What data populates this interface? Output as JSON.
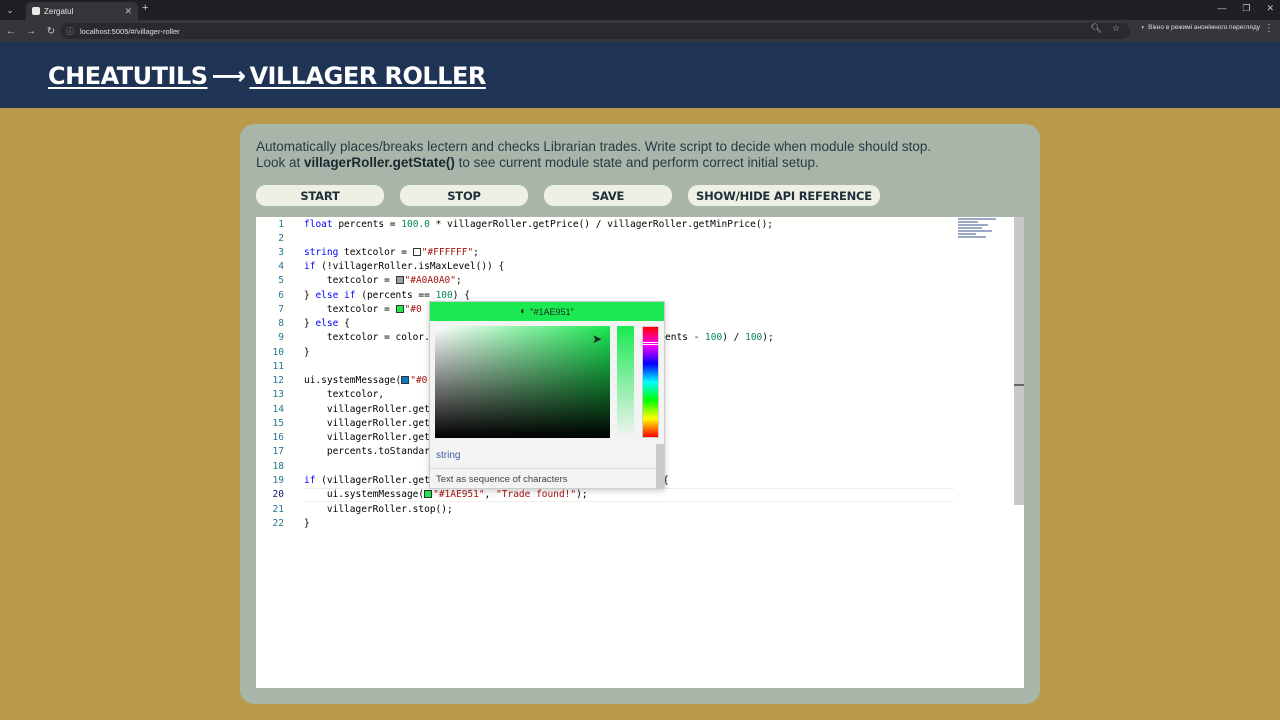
{
  "browser": {
    "tab_title": "Zergatul",
    "url": "localhost:5005/#/villager-roller",
    "incognito_label": "Вікно в режимі анонімного перегляду"
  },
  "header": {
    "crumb1": "CHEATUTILS",
    "arrow": "⟶",
    "crumb2": "VILLAGER ROLLER"
  },
  "description": {
    "line1": "Automatically places/breaks lectern and checks Librarian trades. Write script to decide when module should stop.",
    "line2_prefix": "Look at ",
    "line2_bold": "villagerRoller.getState()",
    "line2_suffix": " to see current module state and perform correct initial setup."
  },
  "buttons": {
    "start": "START",
    "stop": "STOP",
    "save": "SAVE",
    "api": "SHOW/HIDE API REFERENCE"
  },
  "editor": {
    "line_numbers": [
      "1",
      "2",
      "3",
      "4",
      "5",
      "6",
      "7",
      "8",
      "9",
      "10",
      "11",
      "12",
      "13",
      "14",
      "15",
      "16",
      "17",
      "18",
      "19",
      "20",
      "21",
      "22"
    ],
    "lines": {
      "l1a": "float",
      "l1b": " percents = ",
      "l1c": "100.0",
      "l1d": " * villagerRoller.getPrice() / villagerRoller.getMinPrice();",
      "l3a": "string",
      "l3b": " textcolor = ",
      "l3c": "\"#FFFFFF\"",
      "l3d": ";",
      "l4a": "if",
      "l4b": " (!villagerRoller.isMaxLevel()) {",
      "l5a": "    textcolor = ",
      "l5b": "\"#A0A0A0\"",
      "l5c": ";",
      "l6a": "} ",
      "l6b": "else if",
      "l6c": " (percents == ",
      "l6d": "100",
      "l6e": ") {",
      "l7a": "    textcolor = ",
      "l7b": "\"#0",
      "l8a": "} ",
      "l8b": "else",
      "l8c": " {",
      "l9a": "    textcolor = color.",
      "l9b": "ents - ",
      "l9c": "100",
      "l9d": ") / ",
      "l9e": "100",
      "l9f": ");",
      "l10": "}",
      "l12a": "ui.systemMessage(",
      "l12b": "\"#0",
      "l13": "    textcolor,",
      "l14": "    villagerRoller.get",
      "l15": "    villagerRoller.get",
      "l16": "    villagerRoller.get",
      "l17": "    percents.toStandar",
      "l19a": "if",
      "l19b": " (villagerRoller.get",
      "l19c": "{",
      "l20a": "    ui.systemMessage(",
      "l20b": "\"#1AE951\"",
      "l20c": ", ",
      "l20d": "\"Trade found!\"",
      "l20e": ");",
      "l21": "    villagerRoller.stop();",
      "l22": "}"
    },
    "swatches": {
      "white": "#FFFFFF",
      "grey": "#A0A0A0",
      "green": "#1AE951",
      "blue": "#0A7BCB"
    }
  },
  "picker": {
    "value": "\"#1AE951\"",
    "color": "#1AE951",
    "hint_type": "string",
    "hint_desc": "Text as sequence of characters"
  },
  "colors": {
    "background": "#B89A4A",
    "header": "#1F3354",
    "card": "#A8B5A9"
  }
}
